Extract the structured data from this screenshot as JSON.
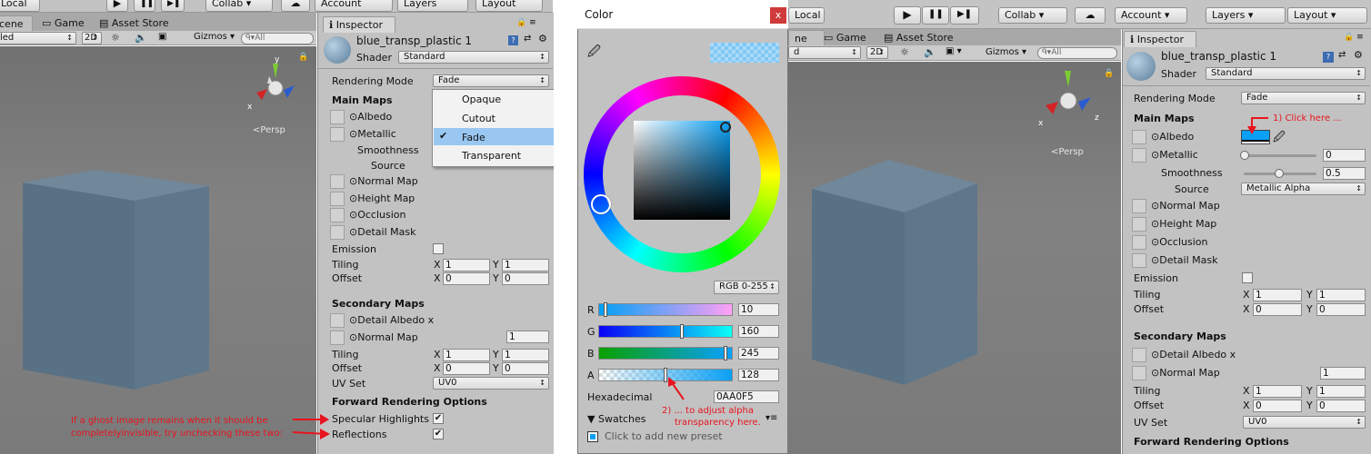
{
  "toolbar_left": {
    "local_label": "Local",
    "play": "▶",
    "pause": "❚❚",
    "step": "▶❚",
    "collab_label": "Collab ▾",
    "account_label": "Account",
    "layers_label": "Layers",
    "layout_label": "Layout"
  },
  "tabs_left": {
    "scene": "cene",
    "game": "Game",
    "asset_store": "Asset Store"
  },
  "scene_toolbar_left": {
    "shading": "led",
    "mode_2d": "2D",
    "gizmos": "Gizmos",
    "search": "All"
  },
  "persp_label": "Persp",
  "inspector": {
    "tab": "Inspector",
    "material_name": "blue_transp_plastic 1",
    "shader_label": "Shader",
    "shader_value": "Standard",
    "rendering_mode_label": "Rendering Mode",
    "rendering_mode_value": "Fade",
    "main_maps": "Main Maps",
    "albedo": "Albedo",
    "metallic": "Metallic",
    "metallic_value": "0",
    "smoothness": "Smoothness",
    "smoothness_value": "0.5",
    "source": "Source",
    "source_value": "Metallic Alpha",
    "normal_map": "Normal Map",
    "height_map": "Height Map",
    "occlusion": "Occlusion",
    "detail_mask": "Detail Mask",
    "emission": "Emission",
    "tiling": "Tiling",
    "offset": "Offset",
    "x": "X",
    "y": "Y",
    "tiling_x": "1",
    "tiling_y": "1",
    "offset_x": "0",
    "offset_y": "0",
    "secondary_maps": "Secondary Maps",
    "detail_albedo": "Detail Albedo x",
    "normal_map2": "Normal Map",
    "normal_map2_value": "1",
    "uv_set": "UV Set",
    "uv_set_value": "UV0",
    "forward_rendering": "Forward Rendering Options",
    "specular_highlights": "Specular Highlights",
    "reflections": "Reflections"
  },
  "rendering_menu": {
    "items": [
      "Opaque",
      "Cutout",
      "Fade",
      "Transparent"
    ],
    "selected": "Fade"
  },
  "note_left": {
    "line1": "If a ghost image remains when it should be",
    "line2": "completelyinvisible, try unchecking these two:"
  },
  "color_picker": {
    "title": "Color",
    "close": "x",
    "mode": "RGB 0-255",
    "r_label": "R",
    "r_value": "10",
    "r": 10,
    "g_label": "G",
    "g_value": "160",
    "g": 160,
    "b_label": "B",
    "b_value": "245",
    "b": 245,
    "a_label": "A",
    "a_value": "128",
    "a": 128,
    "hex_label": "Hexadecimal",
    "hex_value": "0AA0F5",
    "swatches": "Swatches",
    "add_preset": "Click to add new preset",
    "note_line1": "2) ... to adjust alpha",
    "note_line2": "transparency here."
  },
  "toolbar_right": {
    "local_label": "Local",
    "collab_label": "Collab ▾",
    "account_label": "Account",
    "layers_label": "Layers",
    "layout_label": "Layout"
  },
  "tabs_right": {
    "scene": "ne",
    "game": "Game",
    "asset_store": "Asset Store"
  },
  "scene_toolbar_right": {
    "shading": "d",
    "mode_2d": "2D",
    "gizmos": "Gizmos",
    "search": "All"
  },
  "note_right": "1) Click here ...",
  "colors": {
    "accent": "#0AA0F5",
    "panel": "#C2C2C2",
    "annotation": "#E8141E",
    "menu_highlight": "#99C7F2"
  }
}
